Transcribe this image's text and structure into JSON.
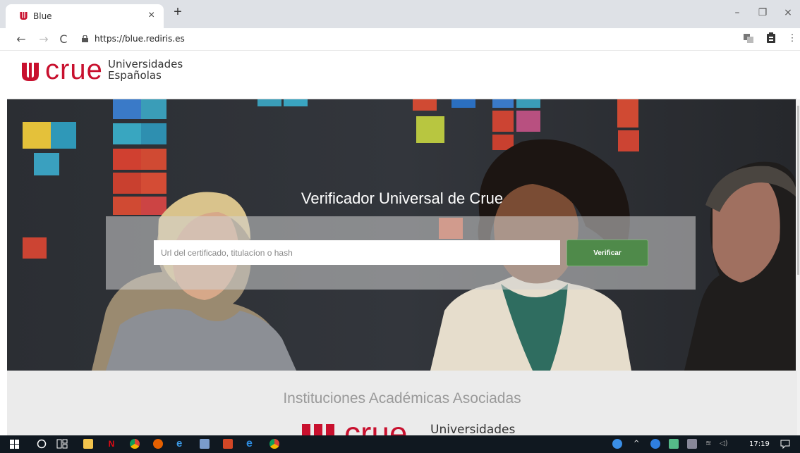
{
  "browser": {
    "tab_title": "Blue",
    "tab_close": "×",
    "new_tab": "+",
    "url": "https://blue.rediris.es",
    "nav": {
      "back": "←",
      "forward": "→",
      "reload": "C"
    },
    "window": {
      "minimize": "–",
      "restore": "❐",
      "close": "×"
    },
    "toolbar_menu": "⋮"
  },
  "site": {
    "logo_word": "crue",
    "logo_sub_line1": "Universidades",
    "logo_sub_line2": "Españolas",
    "brand_color": "#c8102e"
  },
  "hero": {
    "title": "Verificador Universal de Crue",
    "search_placeholder": "Url del certificado, titulacíon o hash",
    "verify_label": "Verificar",
    "button_color": "#4f8a4a"
  },
  "associated": {
    "title": "Instituciones Académicas Asociadas",
    "logo_word": "crue",
    "logo_sub": "Universidades"
  },
  "taskbar": {
    "time": "17:19",
    "apps": [
      "start-icon",
      "search-circle-icon",
      "task-view-icon",
      "file-explorer-icon",
      "netflix-icon",
      "chrome-icon",
      "firefox-icon",
      "edge-icon",
      "paint-icon",
      "powerpoint-icon",
      "ie-icon",
      "chrome-alt-icon"
    ]
  }
}
